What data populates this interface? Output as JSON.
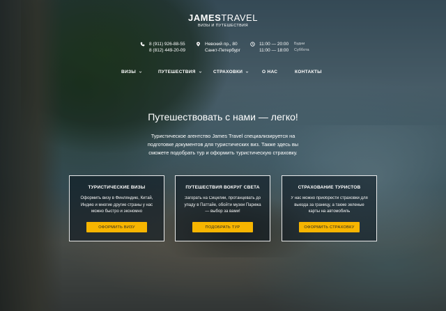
{
  "logo": {
    "name_bold": "JAMES",
    "name_rest": "TRAVEL",
    "tagline": "ВИЗЫ И ПУТЕШЕСТВИЯ"
  },
  "contacts": {
    "phones": [
      "8 (911) 926-88-55",
      "8 (812) 449-20-09"
    ],
    "address": [
      "Невский пр., 80",
      "Санкт-Петербург"
    ],
    "hours": [
      {
        "time": "11:00 — 20:00",
        "days": "Будни"
      },
      {
        "time": "11:00 — 18:00",
        "days": "Суббота"
      }
    ]
  },
  "nav": {
    "items": [
      {
        "label": "ВИЗЫ",
        "dropdown": true
      },
      {
        "label": "ПУТЕШЕСТВИЯ",
        "dropdown": true
      },
      {
        "label": "СТРАХОВКИ",
        "dropdown": true
      },
      {
        "label": "О НАС",
        "dropdown": false
      },
      {
        "label": "КОНТАКТЫ",
        "dropdown": false
      }
    ]
  },
  "hero": {
    "title": "Путешествовать с нами — легко!",
    "text": "Туристическое агентство James Travel специализируется на подготовке документов для туристических виз. Также здесь вы сможете подобрать тур и оформить туристическую страховку."
  },
  "cards": [
    {
      "title": "ТУРИСТИЧЕСКИЕ ВИЗЫ",
      "text": "Оформить визу в Финляндию, Китай, Индию и многие другие страны у нас можно быстро и экономно",
      "button": "ОФОРМИТЬ ВИЗУ"
    },
    {
      "title": "ПУТЕШЕСТВИЯ ВОКРУГ СВЕТА",
      "text": "Загорать на Сицилии, протанцевать до упаду в Паттайе, обойти музеи Парижа — выбор за вами!",
      "button": "ПОДОБРАТЬ ТУР"
    },
    {
      "title": "СТРАХОВАНИЕ ТУРИСТОВ",
      "text": "У нас можно приобрести страховки для выезда за границу, а также зеленые карты на автомобиль",
      "button": "ОФОРМИТЬ СТРАХОВКУ"
    }
  ],
  "colors": {
    "accent": "#f7b500"
  }
}
